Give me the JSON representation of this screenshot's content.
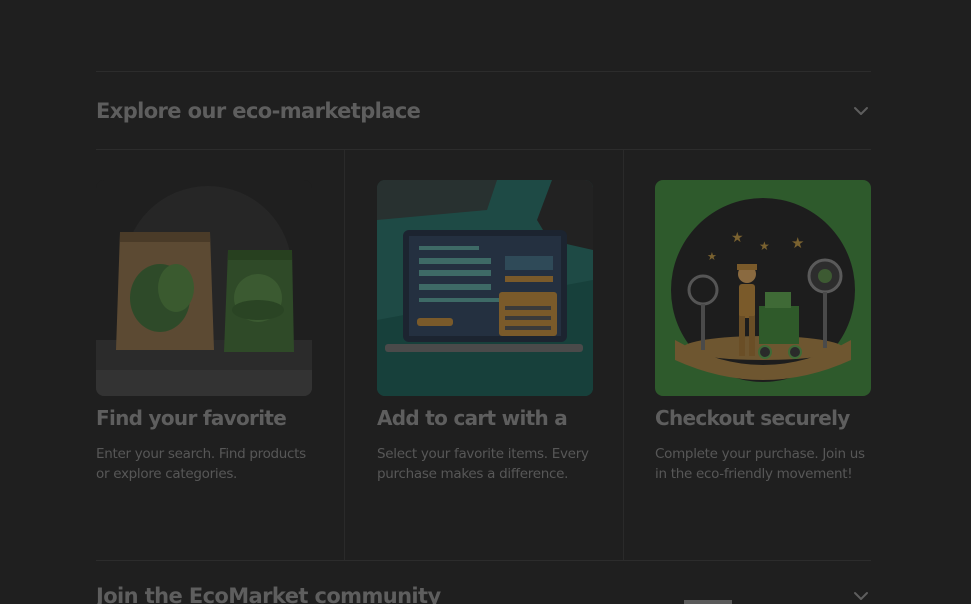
{
  "section_explore": {
    "title": "Explore our eco-marketplace"
  },
  "steps": [
    {
      "title": "Find your favorite",
      "description": "Enter your search. Find products or explore categories.",
      "icon": "eco-product-bags-image"
    },
    {
      "title": "Add to cart with a",
      "description": "Select your favorite items. Every purchase makes a difference.",
      "icon": "laptop-cart-image"
    },
    {
      "title": "Checkout securely",
      "description": "Complete your purchase. Join us in the eco-friendly movement!",
      "icon": "courier-delivery-image"
    }
  ],
  "section_community": {
    "title": "Join the EcoMarket community"
  },
  "colors": {
    "background": "#1f1f1f",
    "heading": "#5e5e5e",
    "body_text": "#575757",
    "accent_teal": "#1e4a45",
    "accent_green": "#2e5a2c"
  }
}
